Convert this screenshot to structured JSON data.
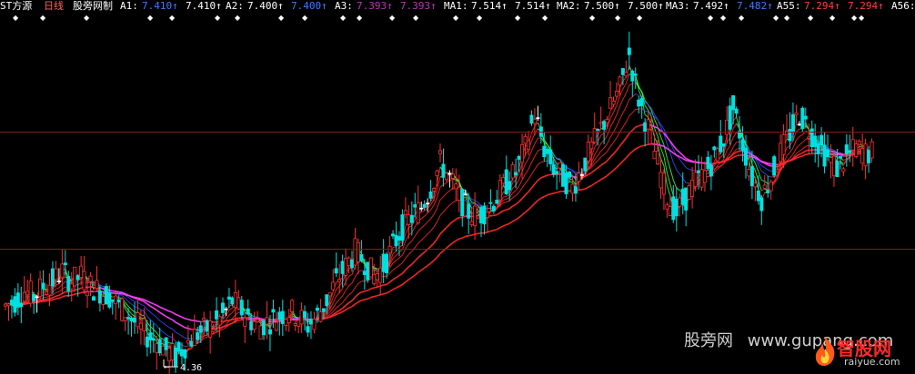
{
  "header": {
    "stock_name": "ST方源",
    "period": "日线",
    "indicator": "股旁网制",
    "items": [
      {
        "name": "A1:",
        "v1": "7.410↑",
        "v2": "7.410↑",
        "c1": "#3b7bff",
        "c2": "#ffffff"
      },
      {
        "name": "A2:",
        "v1": "7.400↑",
        "v2": "7.400↑",
        "c1": "#ffffff",
        "c2": "#3b7bff"
      },
      {
        "name": "A3:",
        "v1": "7.393↑",
        "v2": "7.393↑",
        "c1": "#c030c0",
        "c2": "#c030c0"
      },
      {
        "name": "MA1:",
        "v1": "7.514↑",
        "v2": "7.514↑",
        "c1": "#ffffff",
        "c2": "#ffffff"
      },
      {
        "name": "MA2:",
        "v1": "7.500↑",
        "v2": "7.500↑",
        "c1": "#ffffff",
        "c2": "#ffffff"
      },
      {
        "name": "MA3:",
        "v1": "7.492↑",
        "v2": "7.482↑",
        "c1": "#ffffff",
        "c2": "#3b7bff"
      },
      {
        "name": "A55:",
        "v1": "7.294↑",
        "v2": "7.294↑",
        "c1": "#ff4040",
        "c2": "#ff4040"
      },
      {
        "name": "A56:",
        "v1": "",
        "v2": "",
        "c1": "#ffffff",
        "c2": "#ffffff"
      }
    ]
  },
  "low_label": "4.36",
  "watermark": {
    "site_name": "股旁网",
    "site_url": "www.gupang.com",
    "brand_name": "智股网",
    "brand_url": "raiyue.com"
  },
  "colors": {
    "background": "#000000",
    "up_candle": "#ff3030",
    "down_candle": "#00e0e0",
    "flat_candle": "#ffffff",
    "grid_line": "#8a1a1a",
    "ma_rising": "#ff2a2a",
    "ma_falling_green": "#40ff40",
    "ma_blue": "#3050ff",
    "ma_magenta": "#ff40ff"
  },
  "chart_data": {
    "type": "candlestick",
    "symbol": "ST方源",
    "period": "daily",
    "marked_low": 4.36,
    "closes": [
      5.4,
      5.5,
      5.7,
      5.6,
      5.8,
      5.9,
      6.1,
      5.9,
      6.0,
      5.8,
      5.7,
      5.6,
      5.4,
      5.2,
      5.0,
      4.8,
      4.7,
      4.5,
      4.36,
      4.6,
      4.8,
      4.9,
      5.0,
      5.2,
      5.5,
      5.3,
      5.1,
      5.0,
      5.1,
      5.2,
      5.3,
      5.2,
      5.0,
      5.2,
      5.5,
      5.9,
      6.2,
      6.5,
      6.3,
      6.0,
      6.2,
      6.6,
      7.0,
      7.2,
      7.4,
      7.8,
      8.3,
      8.0,
      7.6,
      7.3,
      7.2,
      7.4,
      7.6,
      7.9,
      8.1,
      8.6,
      9.3,
      8.6,
      8.2,
      8.0,
      7.8,
      8.2,
      8.6,
      9.0,
      9.4,
      9.8,
      10.5,
      9.6,
      9.0,
      8.3,
      7.6,
      7.3,
      7.6,
      7.9,
      8.1,
      8.4,
      8.8,
      9.4,
      8.7,
      8.0,
      7.6,
      8.0,
      8.5,
      8.9,
      9.3,
      9.0,
      8.7,
      8.4,
      8.2,
      8.4,
      8.6,
      8.5,
      8.5
    ]
  }
}
